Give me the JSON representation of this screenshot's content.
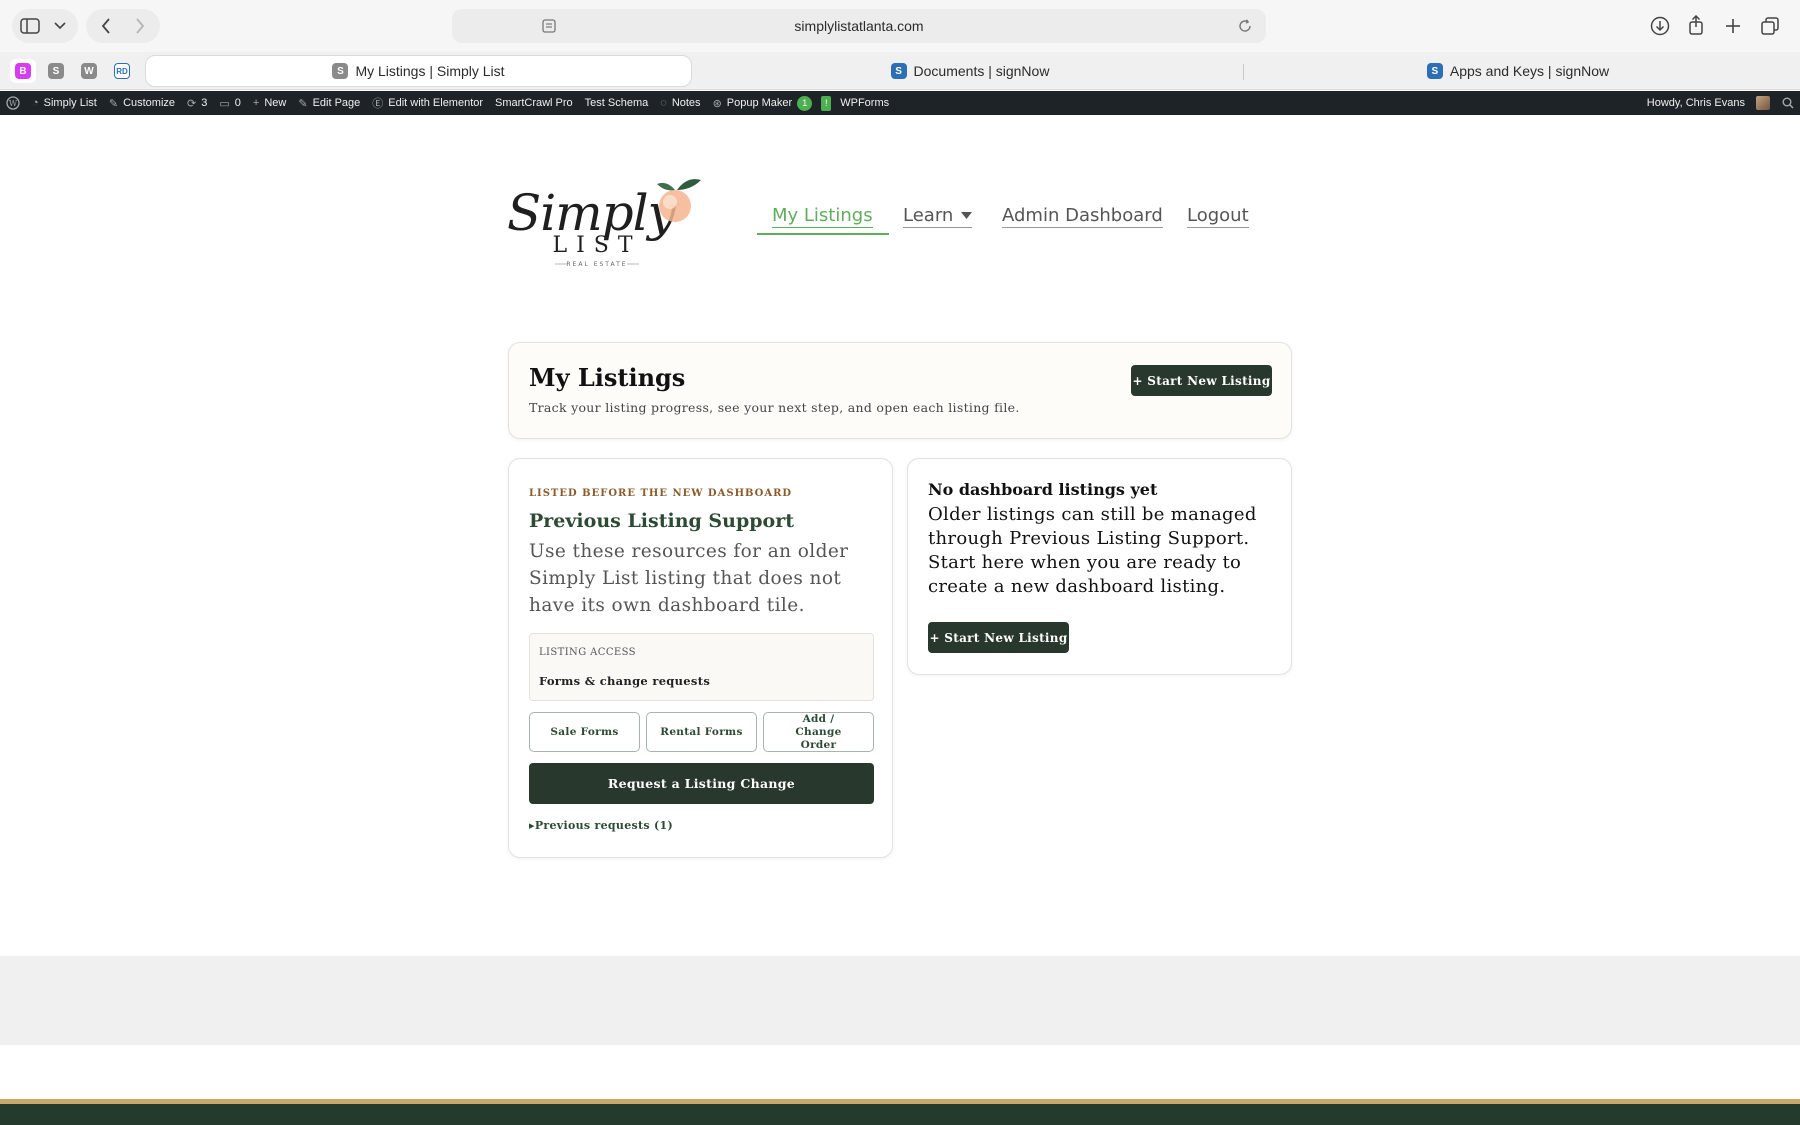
{
  "browser": {
    "url": "simplylistatlanta.com",
    "tabs": [
      {
        "title": "My Listings | Simply List",
        "icon": "S"
      },
      {
        "title": "Documents | signNow",
        "icon": "S"
      },
      {
        "title": "Apps and Keys | signNow",
        "icon": "S"
      }
    ],
    "pinned": [
      "B",
      "S",
      "W",
      "RD"
    ]
  },
  "adminbar": {
    "site": "Simply List",
    "customize": "Customize",
    "updates": "3",
    "comments": "0",
    "new": "New",
    "edit_page": "Edit Page",
    "elementor": "Edit with Elementor",
    "smartcrawl": "SmartCrawl Pro",
    "schema": "Test Schema",
    "notes": "Notes",
    "popup": "Popup Maker",
    "popup_count": "1",
    "alert": "!",
    "wpforms": "WPForms",
    "howdy": "Howdy, Chris Evans"
  },
  "header": {
    "logo": {
      "script": "Simply",
      "word": "LIST",
      "tagline": "REAL ESTATE"
    },
    "nav": {
      "my_listings": "My Listings",
      "learn": "Learn",
      "admin": "Admin Dashboard",
      "logout": "Logout"
    }
  },
  "hero": {
    "title": "My Listings",
    "subtitle": "Track your listing progress, see your next step, and open each listing file.",
    "cta": "+ Start New Listing"
  },
  "legacy": {
    "eyebrow": "LISTED BEFORE THE NEW DASHBOARD",
    "title": "Previous Listing Support",
    "description": "Use these resources for an older Simply List listing that does not have its own dashboard tile.",
    "access_label": "LISTING ACCESS",
    "access_value": "Forms & change requests",
    "sale_forms": "Sale Forms",
    "rental_forms": "Rental Forms",
    "change_order": "Add / Change Order",
    "request": "Request a Listing Change",
    "previous": "Previous requests (1)"
  },
  "empty": {
    "title": "No dashboard listings yet",
    "description": "Older listings can still be managed through Previous Listing Support. Start here when you are ready to create a new dashboard listing.",
    "cta": "+ Start New Listing"
  },
  "colors": {
    "accent_green": "#5fae5b",
    "dark_green": "#28382d",
    "heading_green": "#2c4a34",
    "eyebrow_brown": "#8b5a2b",
    "admin_bar": "#1d2327",
    "footer_gold": "#c9a86a"
  }
}
